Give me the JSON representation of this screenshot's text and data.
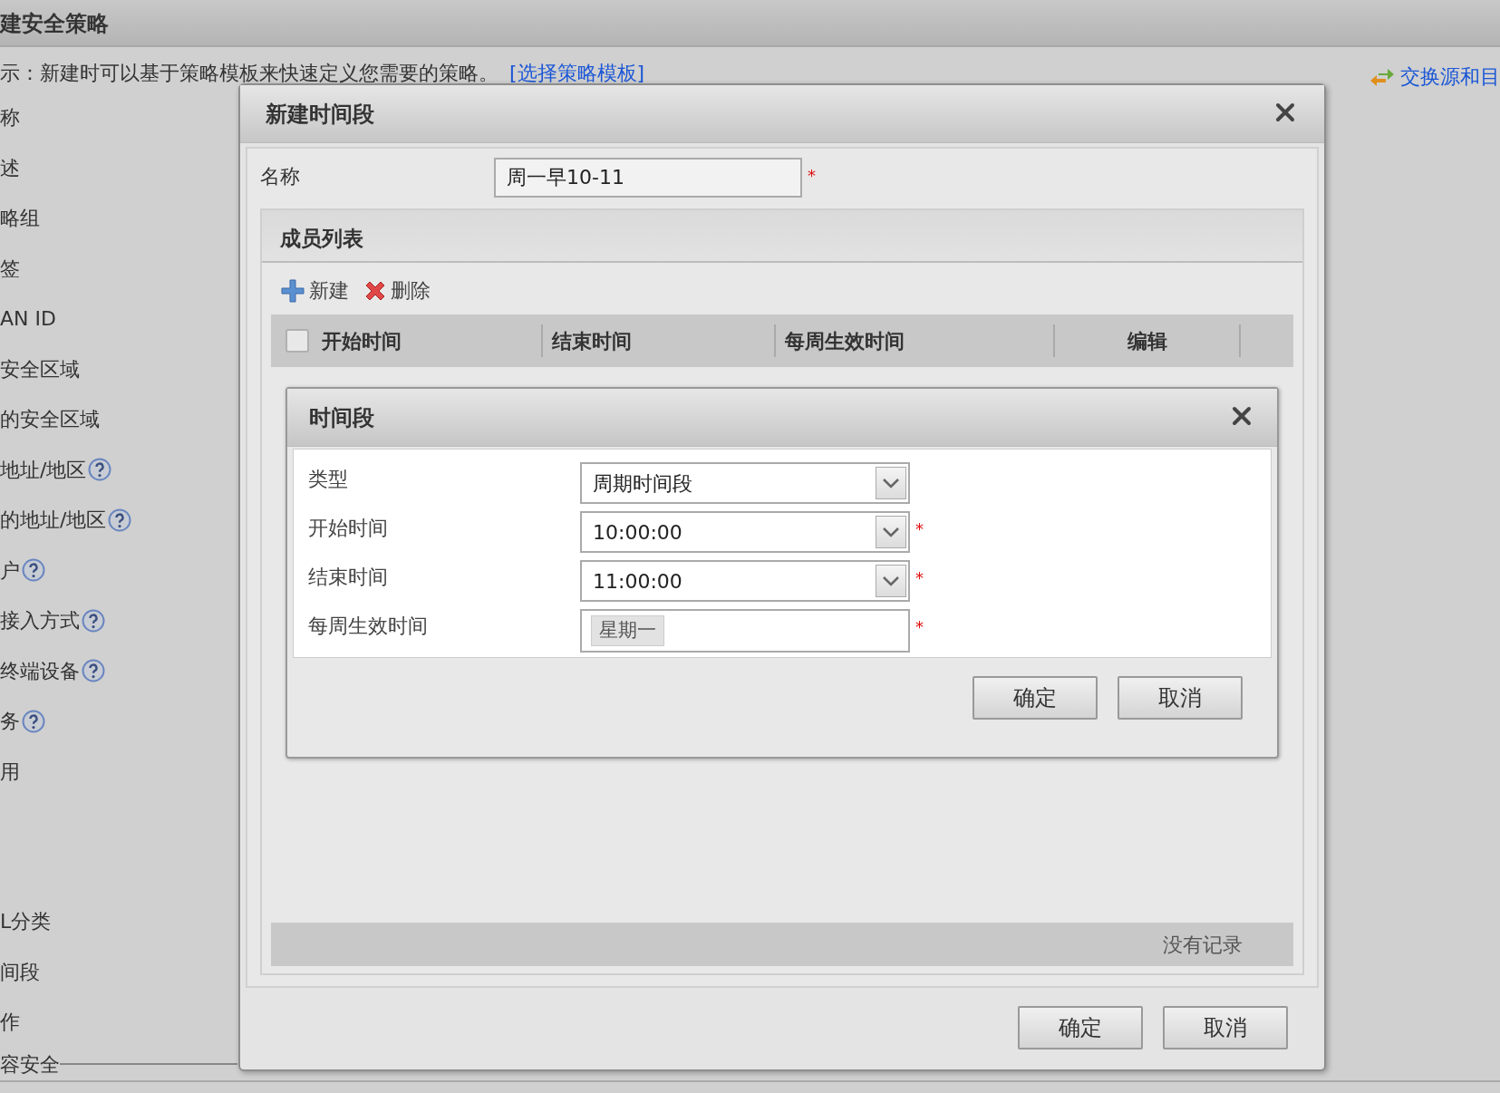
{
  "page": {
    "title": "建安全策略",
    "hint": "示：新建时可以基于策略模板来快速定义您需要的策略。",
    "template_link": "[选择策略模板]",
    "swap_link": "交换源和目"
  },
  "form_labels": [
    {
      "label": "称",
      "help": false
    },
    {
      "label": "述",
      "help": false
    },
    {
      "label": "略组",
      "help": false
    },
    {
      "label": "签",
      "help": false
    },
    {
      "label": "AN ID",
      "help": false
    },
    {
      "label": "安全区域",
      "help": false
    },
    {
      "label": "的安全区域",
      "help": false
    },
    {
      "label": "地址/地区",
      "help": true
    },
    {
      "label": "的地址/地区",
      "help": true
    },
    {
      "label": "户",
      "help": true
    },
    {
      "label": "接入方式",
      "help": true
    },
    {
      "label": "终端设备",
      "help": true
    },
    {
      "label": "务",
      "help": true
    },
    {
      "label": "用",
      "help": false
    }
  ],
  "form_labels_lower": [
    {
      "label": "L分类",
      "help": false
    },
    {
      "label": "间段",
      "help": false
    },
    {
      "label": "作",
      "help": false
    }
  ],
  "section_label": "容安全",
  "dialog": {
    "title": "新建时间段",
    "required_mark": "*",
    "name_label": "名称",
    "name_value": "周一早10-11",
    "name_required": true,
    "members": {
      "title": "成员列表",
      "toolbar": [
        {
          "kind": "add",
          "label": "新建"
        },
        {
          "kind": "delete",
          "label": "删除"
        }
      ],
      "select_all_checked": false,
      "columns": [
        "开始时间",
        "结束时间",
        "每周生效时间",
        "编辑"
      ],
      "empty_text": "没有记录"
    },
    "buttons": [
      "确定",
      "取消"
    ]
  },
  "subdialog": {
    "title": "时间段",
    "fields": [
      {
        "kind": "select",
        "label": "类型",
        "value": "周期时间段",
        "required": false
      },
      {
        "kind": "select",
        "label": "开始时间",
        "value": "10:00:00",
        "required": true
      },
      {
        "kind": "select",
        "label": "结束时间",
        "value": "11:00:00",
        "required": true
      },
      {
        "kind": "tags",
        "label": "每周生效时间",
        "tags": [
          "星期一"
        ],
        "required": true
      }
    ],
    "buttons": [
      "确定",
      "取消"
    ]
  }
}
